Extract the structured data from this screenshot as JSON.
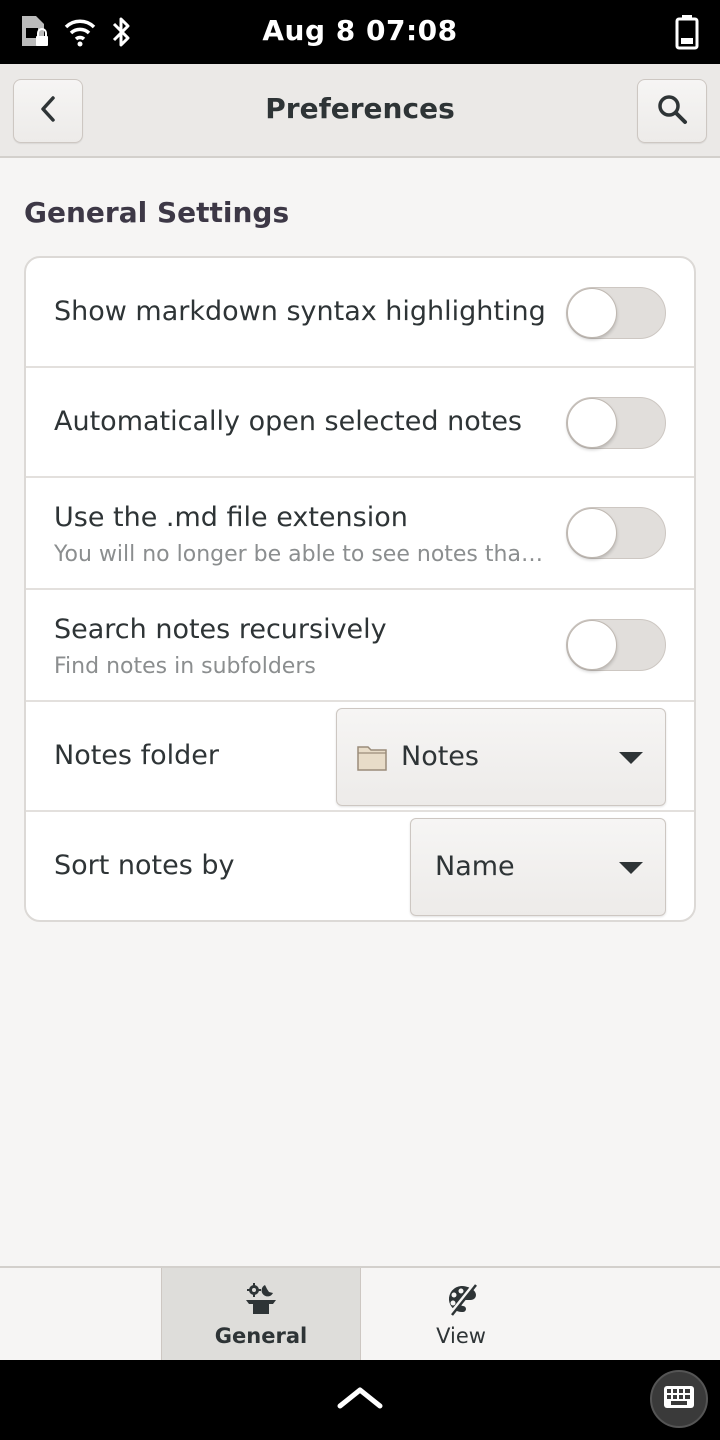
{
  "status_bar": {
    "datetime": "Aug 8  07:08",
    "icons": [
      "sim-card-locked-icon",
      "wifi-icon",
      "bluetooth-icon",
      "battery-icon"
    ]
  },
  "header": {
    "title": "Preferences",
    "back_icon": "chevron-left-icon",
    "search_icon": "search-icon"
  },
  "general": {
    "section_title": "General Settings",
    "rows": [
      {
        "title": "Show markdown syntax highlighting",
        "control": "switch",
        "on": false
      },
      {
        "title": "Automatically open selected notes",
        "control": "switch",
        "on": false
      },
      {
        "title": "Use the .md file extension",
        "subtitle": "You will no longer be able to see notes that…",
        "control": "switch",
        "on": false
      },
      {
        "title": "Search notes recursively",
        "subtitle": "Find notes in subfolders",
        "control": "switch",
        "on": false
      },
      {
        "title": "Notes folder",
        "control": "folder-chooser",
        "value": "Notes",
        "icon": "folder-icon"
      },
      {
        "title": "Sort notes by",
        "control": "dropdown",
        "value": "Name"
      }
    ]
  },
  "view_switcher": {
    "tabs": [
      {
        "label": "General",
        "icon": "preferences-tools-icon",
        "selected": true
      },
      {
        "label": "View",
        "icon": "palette-icon",
        "selected": false
      }
    ]
  },
  "nav": {
    "up_icon": "chevron-up-icon",
    "keyboard_icon": "keyboard-icon"
  },
  "colors": {
    "background": "#f6f5f4",
    "header": "#ebe9e7",
    "card": "#ffffff",
    "switch_off": "#e1dedb",
    "selected_tab": "#deddda"
  }
}
